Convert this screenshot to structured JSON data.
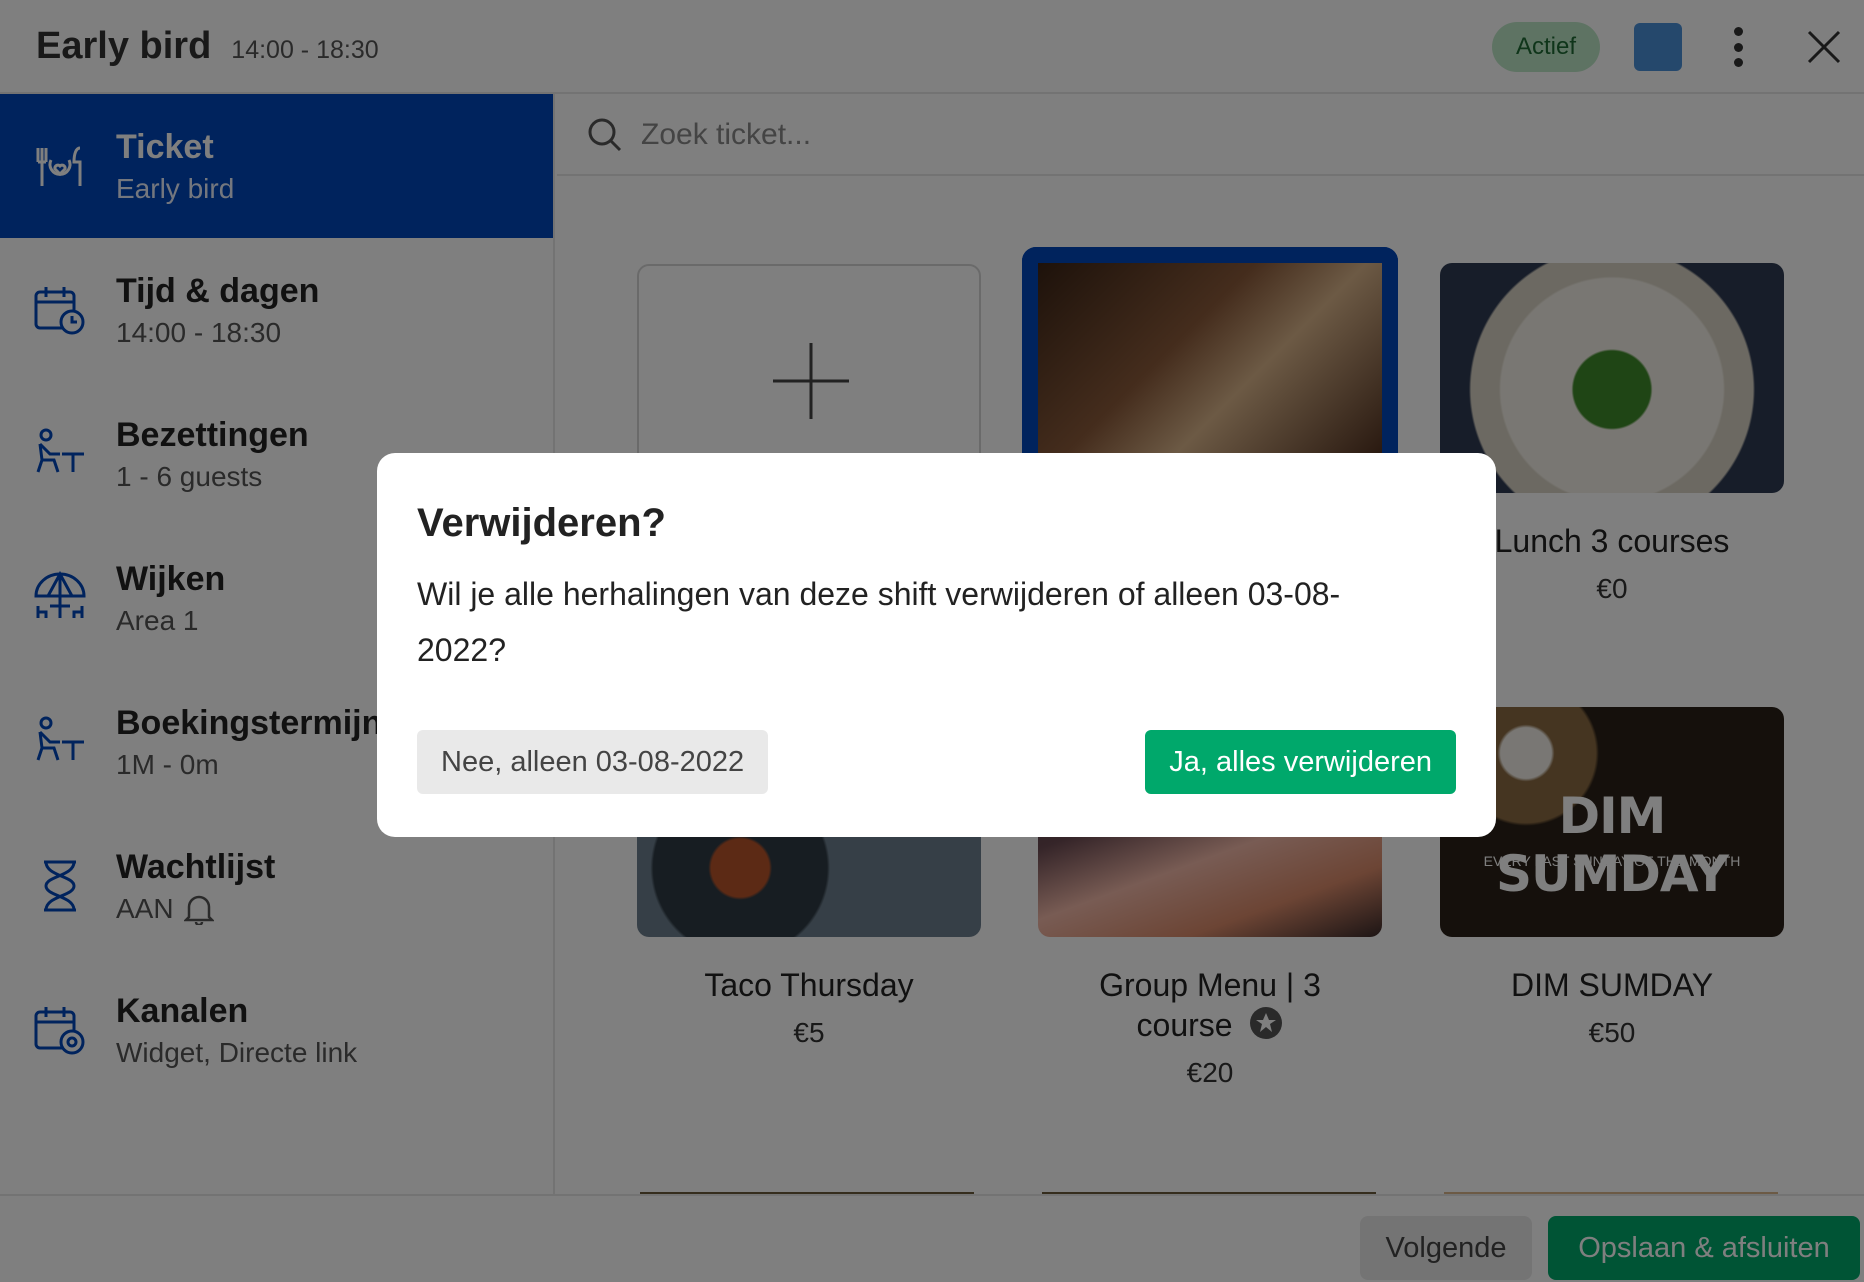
{
  "header": {
    "title": "Early bird",
    "time": "14:00 - 18:30",
    "status_badge": "Actief",
    "badge_color": "#bde6c6",
    "swatch_color": "#4a90d9"
  },
  "sidebar": {
    "items": [
      {
        "label": "Ticket",
        "sub": "Early bird",
        "icon": "ticket-icon",
        "active": true
      },
      {
        "label": "Tijd & dagen",
        "sub": "14:00 - 18:30",
        "icon": "calendar-clock-icon"
      },
      {
        "label": "Bezettingen",
        "sub": "1 - 6 guests",
        "icon": "seating-icon"
      },
      {
        "label": "Wijken",
        "sub": "Area 1",
        "icon": "umbrella-table-icon"
      },
      {
        "label": "Boekingstermijn",
        "sub": "1M - 0m",
        "icon": "seating-icon"
      },
      {
        "label": "Wachtlijst",
        "sub": "AAN",
        "icon": "hourglass-icon"
      },
      {
        "label": "Kanalen",
        "sub": "Widget, Directe link",
        "icon": "calendar-gear-icon"
      }
    ]
  },
  "search": {
    "placeholder": "Zoek ticket..."
  },
  "tickets": [
    {
      "name": "Lunch 3 courses",
      "price": "€0"
    },
    {
      "name": "Taco Thursday",
      "price": "€5"
    },
    {
      "name": "Group Menu | 3 course",
      "name_line1": "Group Menu | 3",
      "name_line2": "course",
      "price": "€20"
    },
    {
      "name": "DIM SUMDAY",
      "price": "€50",
      "img_title": "DIM SUMDAY",
      "img_subtitle": "EVERY LAST SUNDAY OF THE MONTH"
    }
  ],
  "footer": {
    "next_label": "Volgende",
    "save_label": "Opslaan & afsluiten"
  },
  "modal": {
    "title": "Verwijderen?",
    "message": "Wil je alle herhalingen van deze shift verwijderen of alleen 03-08-2022?",
    "cancel_label": "Nee, alleen 03-08-2022",
    "confirm_label": "Ja, alles verwijderen"
  },
  "colors": {
    "accent_blue": "#0047bb",
    "primary_green": "#00a86b"
  }
}
